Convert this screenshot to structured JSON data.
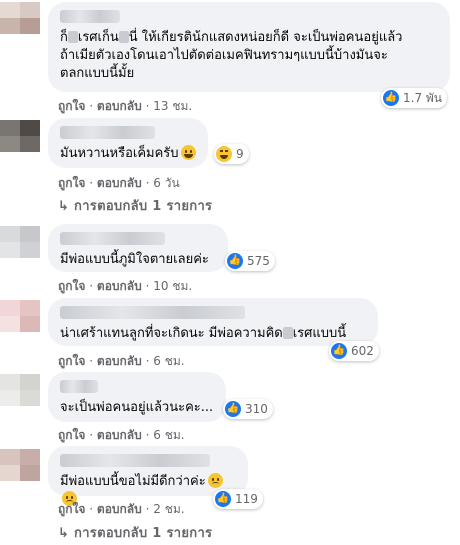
{
  "comments": [
    {
      "text_parts": [
        "ก็",
        "เรศเก็น",
        "นี่ ให้เกียรติน้กแสดงหน่อยก็ดี จะเป็นพ่อคนอยู่แล้ว\nถ้าเมียตัวเองโดนเอาไปตัดต่อเมคฟินทรามๆแบบนี้บ้างมันจะ\nตลกแบบนี้มั้ย"
      ],
      "reaction_count": "1.7 พัน",
      "like_label": "ถูกใจ",
      "reply_label": "ตอบกลับ",
      "time": "13 ชม."
    },
    {
      "text": "มันหวานหรือเค็มครับ",
      "reaction_count": "9",
      "like_label": "ถูกใจ",
      "reply_label": "ตอบกลับ",
      "time": "6 วัน",
      "replies_label": "การตอบกลับ 1 รายการ"
    },
    {
      "text": "มีพ่อแบบนี้ภูมิใจตายเลยค่ะ",
      "reaction_count": "575",
      "like_label": "ถูกใจ",
      "reply_label": "ตอบกลับ",
      "time": "10 ชม."
    },
    {
      "text_parts": [
        "น่าเศร้าแทนลูกที่จะเกิดนะ มีพ่อความคิด",
        "เรศแบบนี้"
      ],
      "reaction_count": "602",
      "like_label": "ถูกใจ",
      "reply_label": "ตอบกลับ",
      "time": "6 ชม."
    },
    {
      "text": "จะเป็นพ่อคนอยู่แล้วนะคะ...",
      "reaction_count": "310",
      "like_label": "ถูกใจ",
      "reply_label": "ตอบกลับ",
      "time": "6 ชม."
    },
    {
      "text": "มีพ่อแบบนี้ขอไม่มีดีกว่าค่ะ",
      "reaction_count": "119",
      "like_label": "ถูกใจ",
      "reply_label": "ตอบกลับ",
      "time": "2 ชม.",
      "replies_label": "การตอบกลับ 1 รายการ"
    }
  ],
  "separator": "·",
  "reply_arrow": "↳",
  "colors": {
    "like_blue": "#1877f2",
    "bubble_bg": "#f0f2f5",
    "meta_gray": "#65676b"
  }
}
